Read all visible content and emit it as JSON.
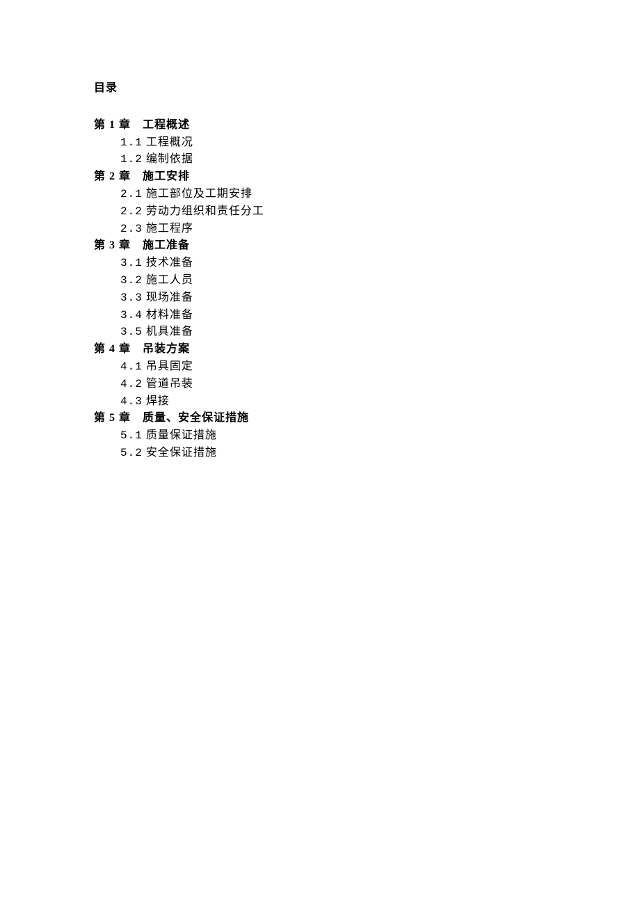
{
  "title": "目录",
  "chapters": [
    {
      "heading": "第 1 章 工程概述",
      "sections": [
        {
          "num": "1.1",
          "label": "工程概况"
        },
        {
          "num": "1.2",
          "label": "编制依据"
        }
      ]
    },
    {
      "heading": "第 2 章 施工安排",
      "sections": [
        {
          "num": "2.1",
          "label": "施工部位及工期安排"
        },
        {
          "num": "2.2",
          "label": "劳动力组织和责任分工"
        },
        {
          "num": "2.3",
          "label": "施工程序"
        }
      ]
    },
    {
      "heading": "第 3 章 施工准备",
      "sections": [
        {
          "num": "3.1",
          "label": "技术准备"
        },
        {
          "num": "3.2",
          "label": "施工人员"
        },
        {
          "num": "3.3",
          "label": "现场准备"
        },
        {
          "num": "3.4",
          "label": "材料准备"
        },
        {
          "num": "3.5",
          "label": "机具准备"
        }
      ]
    },
    {
      "heading": "第 4 章 吊装方案",
      "sections": [
        {
          "num": "4.1",
          "label": "吊具固定"
        },
        {
          "num": "4.2",
          "label": "管道吊装"
        },
        {
          "num": "4.3",
          "label": "焊接"
        }
      ]
    },
    {
      "heading": "第 5 章 质量、安全保证措施",
      "sections": [
        {
          "num": "5.1",
          "label": "质量保证措施"
        },
        {
          "num": "5.2",
          "label": "安全保证措施"
        }
      ]
    }
  ]
}
